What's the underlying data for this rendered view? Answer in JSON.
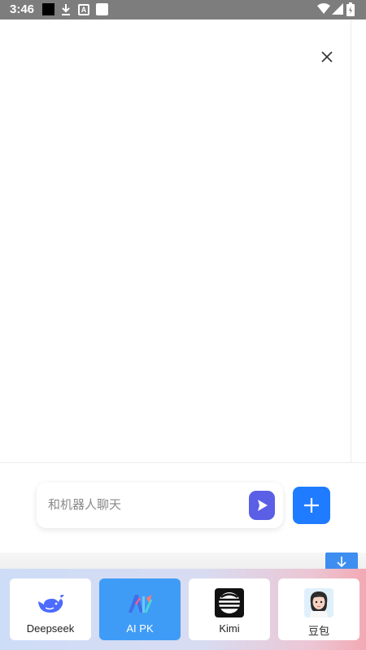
{
  "status_bar": {
    "time": "3:46",
    "icons": [
      "black-square-icon",
      "download-icon",
      "a-box-icon",
      "white-square-icon",
      "wifi-icon",
      "signal-icon",
      "battery-icon"
    ]
  },
  "chat": {
    "input_placeholder": "和机器人聊天",
    "input_value": ""
  },
  "models": [
    {
      "label": "Deepseek",
      "icon": "whale-icon",
      "active": false
    },
    {
      "label": "AI PK",
      "icon": "ai-pk-icon",
      "active": true
    },
    {
      "label": "Kimi",
      "icon": "kimi-icon",
      "active": false
    },
    {
      "label": "豆包",
      "icon": "doubao-avatar-icon",
      "active": false
    }
  ],
  "colors": {
    "status_bar": "#7d7d7d",
    "send_button": "#5a5fe6",
    "add_button": "#1f7bff",
    "active_card": "#3f9cf6"
  }
}
